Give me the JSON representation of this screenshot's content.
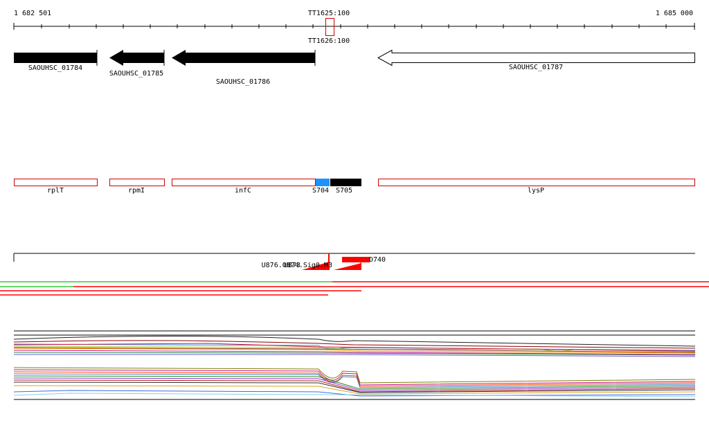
{
  "coordinates": {
    "start": "1 682 501",
    "end": "1 685 000"
  },
  "terminators": {
    "top_label": "TT1625:100",
    "bottom_label": "TT1626:100"
  },
  "genes": [
    {
      "label": "SAOUHSC_01784",
      "style": "filled"
    },
    {
      "label": "SAOUHSC_01785",
      "style": "filled"
    },
    {
      "label": "SAOUHSC_01786",
      "style": "filled"
    },
    {
      "label": "SAOUHSC_01787",
      "style": "outline"
    }
  ],
  "features": [
    {
      "label": "rplT"
    },
    {
      "label": "rpmI"
    },
    {
      "label": "infC"
    },
    {
      "label": "S704",
      "color": "#1e90ff"
    },
    {
      "label": "S705",
      "color": "#000000"
    },
    {
      "label": "lysP"
    }
  ],
  "peaks": {
    "labels": [
      "U876.O874.Sig0.M3",
      "U873"
    ],
    "right_label": "D740"
  },
  "colors": {
    "feature_outline": "#cc0000",
    "peak": "#ff0000",
    "coverage_green": "#33cc33",
    "coverage_red": "#ff0000"
  }
}
